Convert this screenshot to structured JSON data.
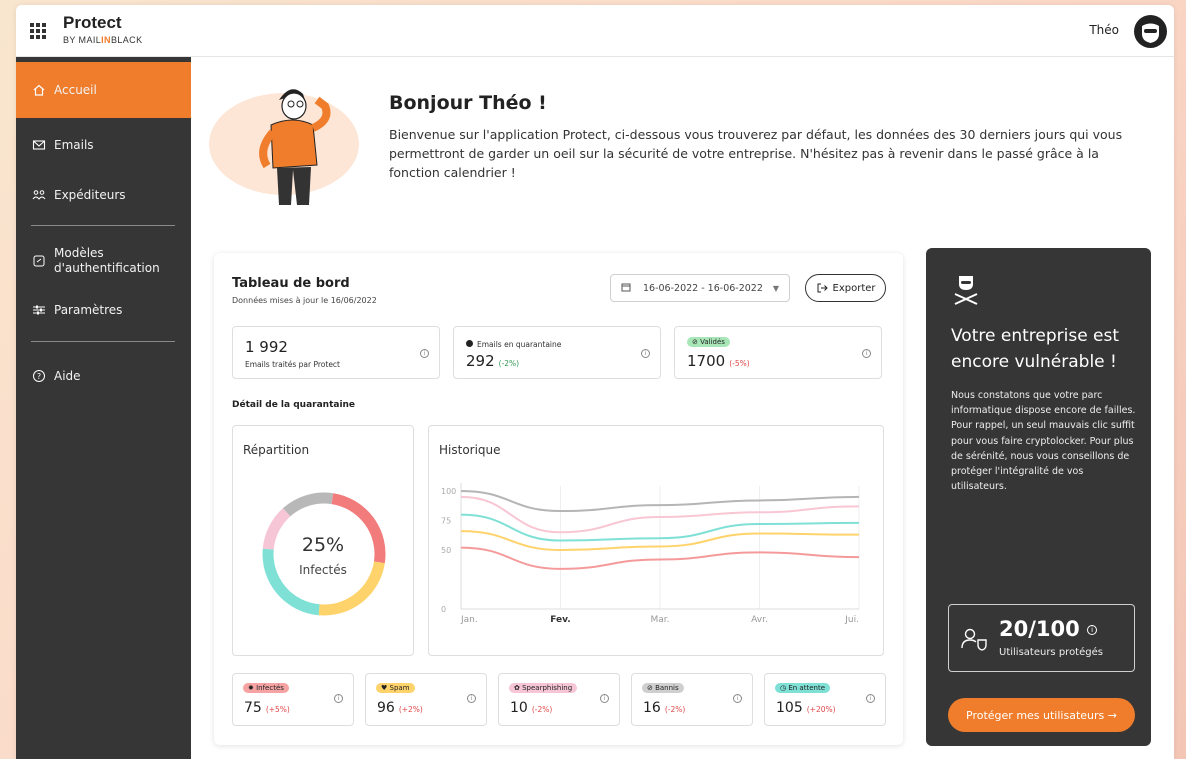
{
  "app": {
    "title": "Protect",
    "subtitle_prefix": "BY MAIL",
    "subtitle_in": "IN",
    "subtitle_suffix": "BLACK",
    "user_name": "Théo"
  },
  "sidebar": {
    "items": [
      {
        "label": "Accueil",
        "icon": "home-icon",
        "active": true
      },
      {
        "label": "Emails",
        "icon": "mail-icon"
      },
      {
        "label": "Expéditeurs",
        "icon": "senders-icon"
      },
      {
        "label": "Modèles d'authentification",
        "icon": "auth-template-icon"
      },
      {
        "label": "Paramètres",
        "icon": "settings-sliders-icon"
      },
      {
        "label": "Aide",
        "icon": "help-icon"
      }
    ]
  },
  "welcome": {
    "title": "Bonjour Théo !",
    "text": "Bienvenue sur l'application Protect, ci-dessous vous trouverez par défaut, les données des 30 derniers jours qui vous permettront de garder un oeil sur la sécurité de votre entreprise. N'hésitez pas à revenir dans le passé grâce à la fonction calendrier !"
  },
  "dashboard": {
    "title": "Tableau de bord",
    "updated": "Données mises à jour le 16/06/2022",
    "date_range": "16-06-2022 - 16-06-2022",
    "export_label": "Exporter",
    "stats": [
      {
        "value": "1 992",
        "label": "Emails traités par Protect"
      },
      {
        "label": "Emails en quarantaine",
        "value": "292",
        "delta": "(-2%)"
      },
      {
        "label": "Validés",
        "value": "1700",
        "delta": "(-5%)"
      }
    ],
    "quarantine_label": "Détail de la quarantaine",
    "repartition": {
      "title": "Répartition",
      "percent": "25%",
      "caption": "Infectés"
    },
    "historique": {
      "title": "Historique"
    },
    "categories": [
      {
        "label": "Infectés",
        "value": "75",
        "delta": "(+5%)",
        "color": "#f27b7b",
        "icon": "virus-icon"
      },
      {
        "label": "Spam",
        "value": "96",
        "delta": "(+2%)",
        "color": "#ffd36b",
        "icon": "spam-icon"
      },
      {
        "label": "Spearphishing",
        "value": "10",
        "delta": "(-2%)",
        "color": "#f7c6d6",
        "icon": "spearphishing-icon"
      },
      {
        "label": "Bannis",
        "value": "16",
        "delta": "(-2%)",
        "color": "#c7c7c7",
        "icon": "banned-icon"
      },
      {
        "label": "En attente",
        "value": "105",
        "delta": "(+20%)",
        "color": "#7fe0d6",
        "icon": "clock-icon"
      }
    ]
  },
  "chart_data": [
    {
      "type": "pie",
      "title": "Répartition",
      "center_label": "25%",
      "center_caption": "Infectés",
      "labels": [
        "Infectés",
        "Spam",
        "Spearphishing",
        "Bannis",
        "En attente"
      ],
      "values": [
        25,
        24,
        25,
        12,
        14
      ],
      "colors": [
        "#f27b7b",
        "#ffd36b",
        "#7fe0d6",
        "#f7c6d6",
        "#b8b8b8"
      ],
      "order_note": "donut"
    },
    {
      "type": "line",
      "title": "Historique",
      "x": [
        "Jan.",
        "Fev.",
        "Mar.",
        "Avr.",
        "Jui."
      ],
      "ylim": [
        0,
        100
      ],
      "yticks": [
        0,
        50,
        75,
        100
      ],
      "series": [
        {
          "color": "#b5b5b5",
          "values": [
            100,
            83,
            88,
            92,
            95
          ]
        },
        {
          "color": "#f9c6d4",
          "values": [
            95,
            65,
            78,
            82,
            87
          ]
        },
        {
          "color": "#7fe0d6",
          "values": [
            80,
            58,
            60,
            72,
            73
          ]
        },
        {
          "color": "#ffd36b",
          "values": [
            66,
            50,
            53,
            64,
            63
          ]
        },
        {
          "color": "#f59a9a",
          "values": [
            52,
            34,
            42,
            48,
            44
          ]
        }
      ]
    }
  ],
  "vulnerable": {
    "title": "Votre entreprise est encore vulnérable !",
    "text": "Nous constatons que votre parc informatique dispose encore de failles. Pour rappel, un seul mauvais clic suffit pour vous faire cryptolocker. Pour plus de sérénité, nous vous conseillons de protéger l'intégralité de vos utilisateurs.",
    "protected_value": "20/100",
    "protected_label": "Utilisateurs protégés",
    "button_label": "Protéger mes utilisateurs →"
  }
}
